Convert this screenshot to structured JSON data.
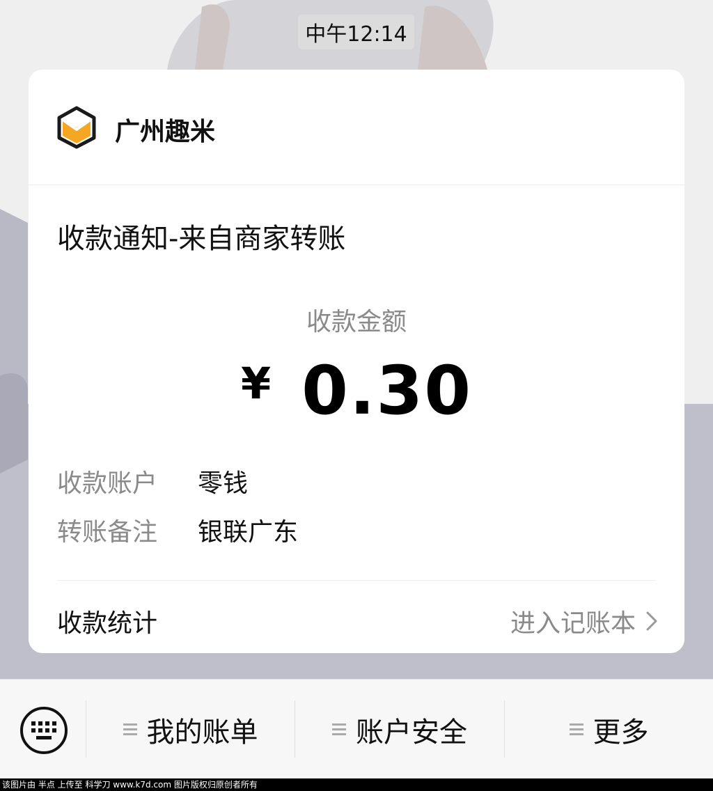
{
  "chat": {
    "timestamp": "中午12:14"
  },
  "card": {
    "merchant_name": "广州趣米",
    "merchant_logo_icon": "cube-envelope-icon",
    "logo_colors": {
      "outline": "#1a1a1a",
      "fill": "#f5a623"
    },
    "title": "收款通知-来自商家转账",
    "amount_label": "收款金额",
    "currency": "¥",
    "amount": "0.30",
    "details": [
      {
        "label": "收款账户",
        "value": "零钱"
      },
      {
        "label": "转账备注",
        "value": "银联广东"
      }
    ],
    "footer": {
      "label": "收款统计",
      "link": "进入记账本",
      "link_icon": "chevron-right-icon"
    }
  },
  "bottom_menu": {
    "keyboard_icon": "keyboard-icon",
    "items": [
      {
        "label": "我的账单",
        "icon": "menu-lines-icon"
      },
      {
        "label": "账户安全",
        "icon": "menu-lines-icon"
      },
      {
        "label": "更多",
        "icon": "menu-lines-icon"
      }
    ]
  },
  "watermark": "该图片由 半点 上传至 科学刀 www.k7d.com 图片版权归原创者所有"
}
